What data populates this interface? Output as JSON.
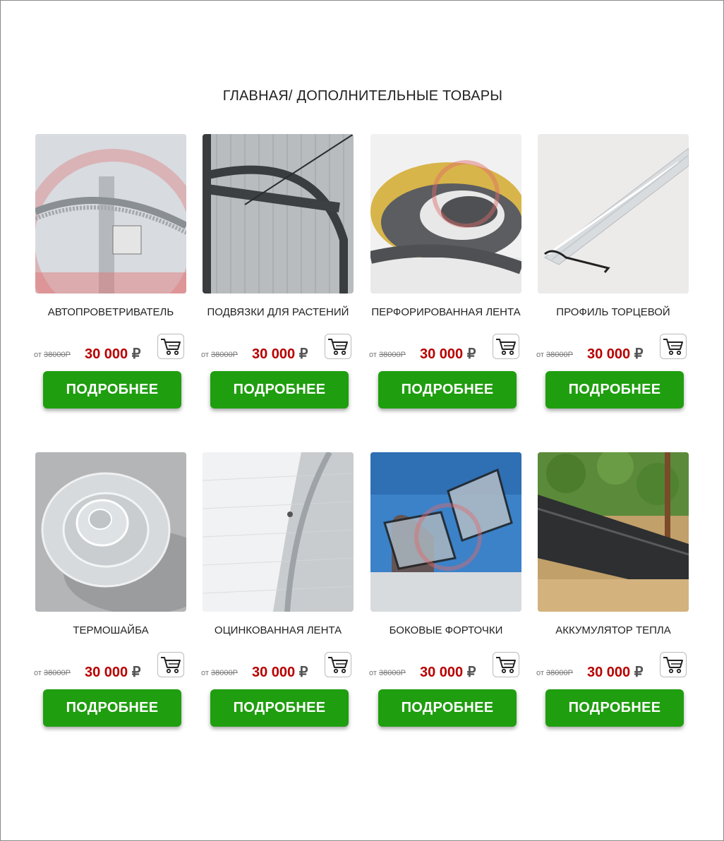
{
  "breadcrumb": {
    "home": "ГЛАВНАЯ/",
    "current": "ДОПОЛНИТЕЛЬНЫЕ ТОВАРЫ"
  },
  "cart_icon": "shopping-cart-icon",
  "colors": {
    "price": "#b80000",
    "button": "#1f9e0f",
    "button_text": "#ffffff"
  },
  "products": [
    {
      "title": "АВТОПРОВЕТРИВАТЕЛЬ",
      "old_prefix": "от",
      "old_price": "38000Р",
      "price": "30 000",
      "currency": "₽",
      "button": "ПОДРОБНЕЕ"
    },
    {
      "title": "ПОДВЯЗКИ ДЛЯ РАСТЕНИЙ",
      "old_prefix": "от",
      "old_price": "38000Р",
      "price": "30 000",
      "currency": "₽",
      "button": "ПОДРОБНЕЕ"
    },
    {
      "title": "ПЕРФОРИРОВАННАЯ ЛЕНТА",
      "old_prefix": "от",
      "old_price": "38000Р",
      "price": "30 000",
      "currency": "₽",
      "button": "ПОДРОБНЕЕ"
    },
    {
      "title": "ПРОФИЛЬ ТОРЦЕВОЙ",
      "old_prefix": "от",
      "old_price": "38000Р",
      "price": "30 000",
      "currency": "₽",
      "button": "ПОДРОБНЕЕ"
    },
    {
      "title": "ТЕРМОШАЙБА",
      "old_prefix": "от",
      "old_price": "38000Р",
      "price": "30 000",
      "currency": "₽",
      "button": "ПОДРОБНЕЕ"
    },
    {
      "title": "ОЦИНКОВАННАЯ ЛЕНТА",
      "old_prefix": "от",
      "old_price": "38000Р",
      "price": "30 000",
      "currency": "₽",
      "button": "ПОДРОБНЕЕ"
    },
    {
      "title": "БОКОВЫЕ ФОРТОЧКИ",
      "old_prefix": "от",
      "old_price": "38000Р",
      "price": "30 000",
      "currency": "₽",
      "button": "ПОДРОБНЕЕ"
    },
    {
      "title": "АККУМУЛЯТОР ТЕПЛА",
      "old_prefix": "от",
      "old_price": "38000Р",
      "price": "30 000",
      "currency": "₽",
      "button": "ПОДРОБНЕЕ"
    }
  ]
}
